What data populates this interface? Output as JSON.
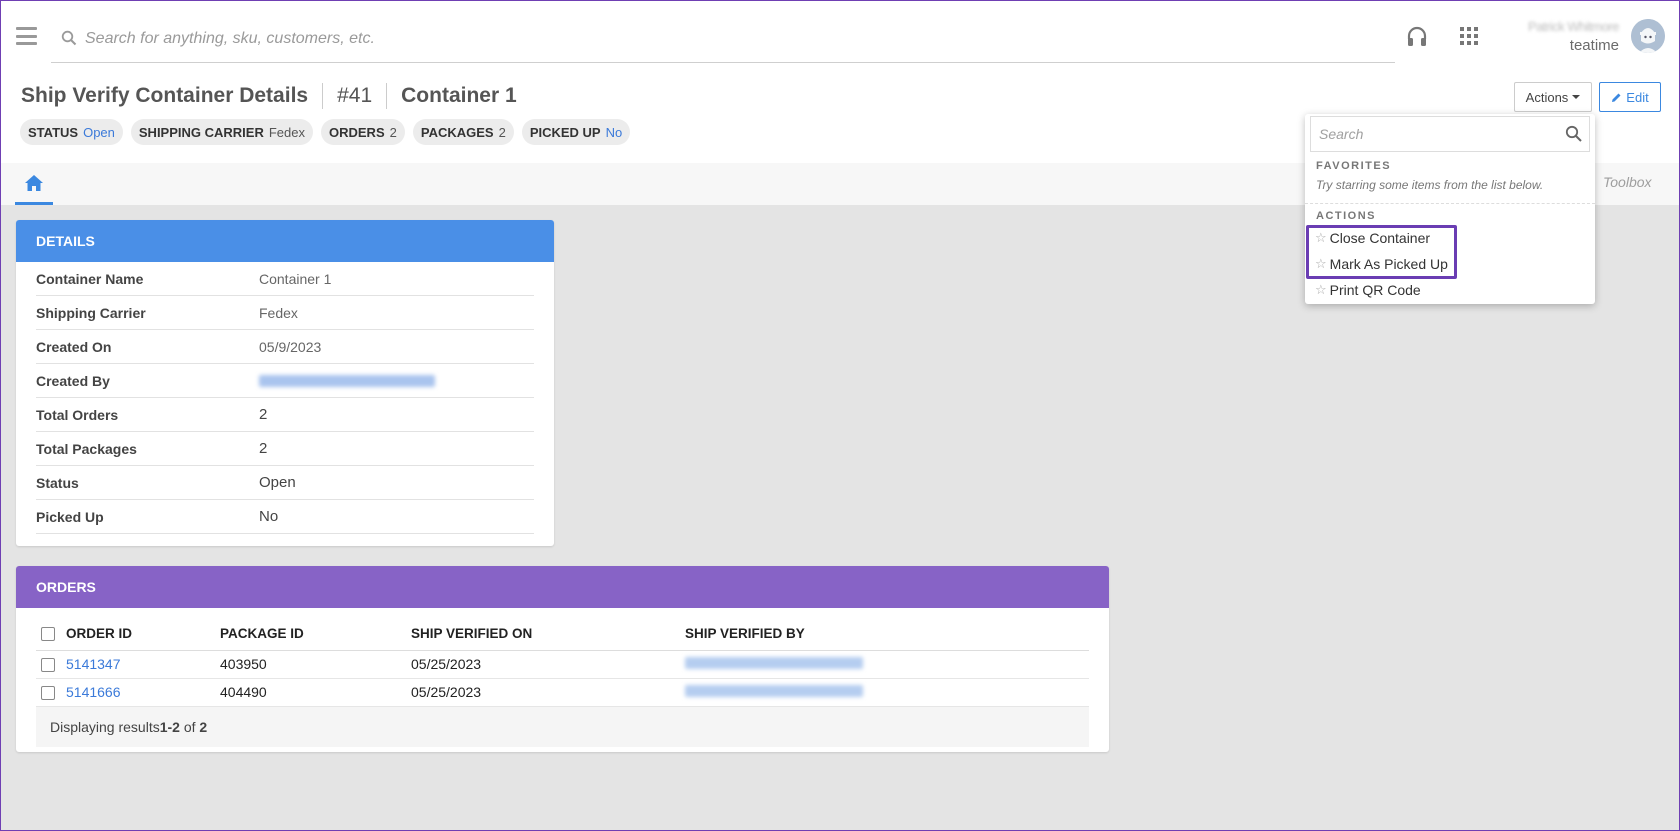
{
  "topbar": {
    "search_placeholder": "Search for anything, sku, customers, etc.",
    "user_name": "Patrick Whitmore",
    "org": "teatime"
  },
  "header": {
    "title": "Ship Verify Container Details",
    "number": "#41",
    "container": "Container 1",
    "chips": [
      {
        "key": "STATUS",
        "value": "Open"
      },
      {
        "key": "SHIPPING CARRIER",
        "value": "Fedex"
      },
      {
        "key": "ORDERS",
        "value": "2"
      },
      {
        "key": "PACKAGES",
        "value": "2"
      },
      {
        "key": "PICKED UP",
        "value": "No"
      }
    ],
    "actions_label": "Actions",
    "edit_label": "Edit"
  },
  "tabs": {
    "toolbox": "Toolbox"
  },
  "actions_menu": {
    "search_placeholder": "Search",
    "favorites_title": "FAVORITES",
    "favorites_hint": "Try starring some items from the list below.",
    "actions_title": "ACTIONS",
    "items": [
      "Close Container",
      "Mark As Picked Up",
      "Print QR Code"
    ]
  },
  "details": {
    "title": "DETAILS",
    "rows": [
      {
        "label": "Container Name",
        "value": "Container 1"
      },
      {
        "label": "Shipping Carrier",
        "value": "Fedex"
      },
      {
        "label": "Created On",
        "value": "05/9/2023"
      },
      {
        "label": "Created By",
        "value": ""
      },
      {
        "label": "Total Orders",
        "value": "2"
      },
      {
        "label": "Total Packages",
        "value": "2"
      },
      {
        "label": "Status",
        "value": "Open"
      },
      {
        "label": "Picked Up",
        "value": "No"
      }
    ]
  },
  "orders": {
    "title": "ORDERS",
    "columns": [
      "ORDER ID",
      "PACKAGE ID",
      "SHIP VERIFIED ON",
      "SHIP VERIFIED BY"
    ],
    "rows": [
      {
        "order_id": "5141347",
        "package_id": "403950",
        "verified_on": "05/25/2023"
      },
      {
        "order_id": "5141666",
        "package_id": "404490",
        "verified_on": "05/25/2023"
      }
    ],
    "footer_prefix": "Displaying results ",
    "footer_range": "1-2",
    "footer_of": " of ",
    "footer_total": "2"
  },
  "colors": {
    "accent_blue": "#4a8fe7",
    "orders_purple": "#8763c6",
    "highlight": "#6a3db3"
  }
}
